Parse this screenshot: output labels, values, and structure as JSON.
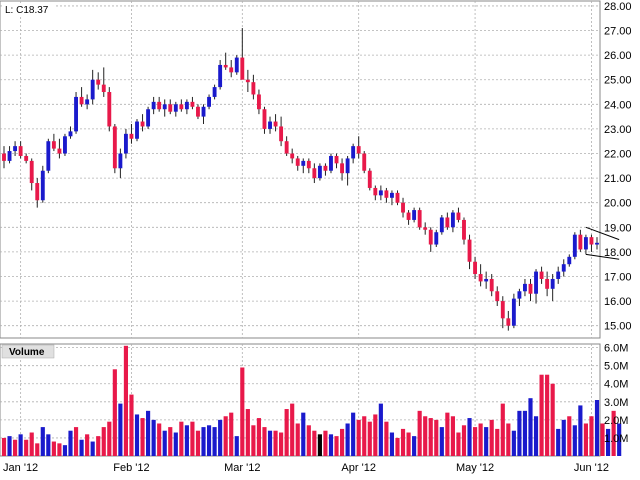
{
  "chart_data": [
    {
      "type": "candlestick",
      "legend_text": "L: C18.37",
      "y_ticks": [
        "28.00",
        "27.00",
        "26.00",
        "25.00",
        "24.00",
        "23.00",
        "22.00",
        "21.00",
        "20.00",
        "19.00",
        "18.00",
        "17.00",
        "16.00",
        "15.00"
      ],
      "ylim": [
        14.5,
        28.2
      ],
      "x_ticks": [
        {
          "label": "Jan '12",
          "index": 3
        },
        {
          "label": "Feb '12",
          "index": 23
        },
        {
          "label": "Mar '12",
          "index": 43
        },
        {
          "label": "Apr '12",
          "index": 64
        },
        {
          "label": "May '12",
          "index": 85
        },
        {
          "label": "Jun '12",
          "index": 106
        }
      ],
      "grid": true,
      "up_color": "#1a1acc",
      "down_color": "#e8194a",
      "ohlc": [
        [
          22.0,
          22.3,
          21.4,
          21.7
        ],
        [
          21.7,
          22.3,
          21.6,
          22.1
        ],
        [
          22.1,
          22.5,
          21.9,
          22.3
        ],
        [
          22.3,
          22.5,
          21.8,
          21.9
        ],
        [
          21.9,
          22.0,
          21.6,
          21.7
        ],
        [
          21.7,
          21.8,
          20.5,
          20.8
        ],
        [
          20.8,
          21.0,
          19.8,
          20.1
        ],
        [
          20.1,
          21.5,
          20.0,
          21.3
        ],
        [
          21.3,
          22.6,
          21.2,
          22.5
        ],
        [
          22.5,
          22.8,
          22.1,
          22.2
        ],
        [
          22.2,
          22.6,
          21.8,
          22.0
        ],
        [
          22.0,
          22.8,
          21.9,
          22.7
        ],
        [
          22.7,
          23.1,
          22.6,
          22.9
        ],
        [
          22.9,
          24.5,
          22.8,
          24.3
        ],
        [
          24.3,
          24.7,
          23.9,
          24.0
        ],
        [
          24.0,
          24.4,
          23.8,
          24.2
        ],
        [
          24.2,
          25.4,
          24.0,
          25.0
        ],
        [
          25.0,
          25.3,
          24.6,
          24.8
        ],
        [
          24.8,
          25.5,
          24.3,
          24.5
        ],
        [
          24.5,
          24.7,
          22.9,
          23.1
        ],
        [
          23.1,
          23.2,
          21.2,
          21.4
        ],
        [
          21.4,
          22.2,
          21.0,
          22.0
        ],
        [
          22.0,
          23.0,
          21.8,
          22.8
        ],
        [
          22.8,
          23.2,
          22.4,
          22.6
        ],
        [
          22.6,
          23.4,
          22.5,
          23.3
        ],
        [
          23.3,
          23.6,
          22.9,
          23.1
        ],
        [
          23.1,
          23.9,
          23.0,
          23.8
        ],
        [
          23.8,
          24.3,
          23.6,
          24.1
        ],
        [
          24.1,
          24.3,
          23.7,
          23.8
        ],
        [
          23.8,
          24.2,
          23.5,
          24.0
        ],
        [
          24.0,
          24.2,
          23.6,
          23.7
        ],
        [
          23.7,
          24.1,
          23.5,
          24.0
        ],
        [
          24.0,
          24.2,
          23.7,
          23.8
        ],
        [
          23.8,
          24.2,
          23.6,
          24.1
        ],
        [
          24.1,
          24.3,
          23.8,
          23.9
        ],
        [
          23.9,
          24.0,
          23.4,
          23.5
        ],
        [
          23.5,
          24.0,
          23.2,
          23.9
        ],
        [
          23.9,
          24.4,
          23.8,
          24.3
        ],
        [
          24.3,
          24.8,
          24.2,
          24.7
        ],
        [
          24.7,
          25.8,
          24.6,
          25.6
        ],
        [
          25.6,
          26.1,
          25.4,
          25.5
        ],
        [
          25.5,
          25.8,
          25.1,
          25.3
        ],
        [
          25.3,
          26.0,
          25.2,
          25.9
        ],
        [
          25.9,
          27.1,
          25.3,
          25.0
        ],
        [
          25.0,
          25.4,
          24.5,
          24.9
        ],
        [
          24.9,
          25.2,
          24.2,
          24.4
        ],
        [
          24.4,
          24.6,
          23.6,
          23.8
        ],
        [
          23.8,
          23.9,
          22.8,
          23.0
        ],
        [
          23.0,
          23.5,
          22.8,
          23.3
        ],
        [
          23.3,
          23.6,
          22.9,
          23.1
        ],
        [
          23.1,
          23.5,
          22.3,
          22.5
        ],
        [
          22.5,
          22.7,
          21.9,
          22.0
        ],
        [
          22.0,
          22.2,
          21.6,
          21.8
        ],
        [
          21.8,
          21.9,
          21.3,
          21.5
        ],
        [
          21.5,
          21.8,
          21.2,
          21.7
        ],
        [
          21.7,
          21.8,
          21.2,
          21.4
        ],
        [
          21.4,
          21.6,
          20.8,
          21.0
        ],
        [
          21.0,
          21.6,
          20.9,
          21.5
        ],
        [
          21.5,
          21.6,
          21.1,
          21.3
        ],
        [
          21.3,
          22.0,
          21.2,
          21.9
        ],
        [
          21.9,
          22.0,
          21.4,
          21.6
        ],
        [
          21.6,
          21.8,
          20.9,
          21.2
        ],
        [
          21.2,
          21.9,
          20.7,
          21.8
        ],
        [
          21.8,
          22.4,
          21.6,
          22.3
        ],
        [
          22.3,
          22.7,
          21.8,
          22.0
        ],
        [
          22.0,
          22.1,
          21.2,
          21.3
        ],
        [
          21.3,
          21.4,
          20.5,
          20.6
        ],
        [
          20.6,
          20.7,
          20.1,
          20.3
        ],
        [
          20.3,
          20.7,
          20.1,
          20.5
        ],
        [
          20.5,
          20.6,
          20.0,
          20.2
        ],
        [
          20.2,
          20.5,
          19.9,
          20.4
        ],
        [
          20.4,
          20.5,
          19.9,
          20.0
        ],
        [
          20.0,
          20.2,
          19.4,
          19.6
        ],
        [
          19.6,
          19.7,
          19.1,
          19.3
        ],
        [
          19.3,
          19.8,
          19.2,
          19.7
        ],
        [
          19.7,
          19.8,
          18.9,
          19.0
        ],
        [
          19.0,
          19.2,
          18.7,
          18.9
        ],
        [
          18.9,
          19.0,
          18.0,
          18.3
        ],
        [
          18.3,
          18.9,
          18.2,
          18.8
        ],
        [
          18.8,
          19.5,
          18.7,
          19.4
        ],
        [
          19.4,
          19.6,
          18.9,
          19.0
        ],
        [
          19.0,
          19.7,
          18.8,
          19.6
        ],
        [
          19.6,
          19.8,
          19.2,
          19.3
        ],
        [
          19.3,
          19.4,
          18.3,
          18.5
        ],
        [
          18.5,
          18.7,
          17.3,
          17.6
        ],
        [
          17.6,
          17.8,
          16.9,
          17.1
        ],
        [
          17.1,
          17.5,
          16.6,
          16.8
        ],
        [
          16.8,
          17.2,
          16.5,
          16.9
        ],
        [
          16.9,
          17.1,
          16.2,
          16.4
        ],
        [
          16.4,
          16.6,
          15.8,
          16.0
        ],
        [
          16.0,
          16.2,
          14.9,
          15.3
        ],
        [
          15.3,
          15.6,
          14.8,
          15.0
        ],
        [
          15.0,
          16.3,
          14.9,
          16.1
        ],
        [
          16.1,
          16.5,
          15.8,
          16.4
        ],
        [
          16.4,
          16.9,
          16.2,
          16.7
        ],
        [
          16.7,
          16.9,
          16.0,
          16.3
        ],
        [
          16.3,
          17.3,
          15.9,
          17.2
        ],
        [
          17.2,
          17.4,
          16.7,
          16.9
        ],
        [
          16.9,
          17.2,
          16.2,
          16.5
        ],
        [
          16.5,
          17.1,
          16.0,
          16.9
        ],
        [
          16.9,
          17.4,
          16.7,
          17.2
        ],
        [
          17.2,
          17.7,
          17.0,
          17.5
        ],
        [
          17.5,
          17.9,
          17.4,
          17.8
        ],
        [
          17.8,
          18.8,
          17.7,
          18.7
        ],
        [
          18.7,
          18.9,
          18.0,
          18.1
        ],
        [
          18.1,
          18.7,
          17.9,
          18.6
        ],
        [
          18.6,
          18.7,
          18.0,
          18.3
        ],
        [
          18.3,
          18.6,
          18.1,
          18.37
        ]
      ],
      "trendlines": [
        {
          "from": [
            105,
            19.0
          ],
          "to": [
            111,
            18.5
          ]
        },
        {
          "from": [
            105,
            17.9
          ],
          "to": [
            111,
            17.7
          ]
        }
      ]
    },
    {
      "type": "bar",
      "label": "Volume",
      "y_ticks": [
        "6.0M",
        "5.0M",
        "4.0M",
        "3.0M",
        "2.0M",
        "1.0M"
      ],
      "ylim": [
        0,
        6.2
      ],
      "values": [
        1.0,
        1.1,
        0.9,
        1.2,
        0.9,
        1.3,
        0.7,
        1.6,
        1.2,
        0.8,
        0.7,
        0.6,
        1.4,
        1.6,
        0.9,
        1.2,
        0.8,
        1.1,
        1.6,
        1.9,
        4.8,
        2.9,
        6.1,
        3.4,
        2.3,
        2.1,
        2.5,
        2.0,
        1.8,
        1.4,
        1.6,
        1.3,
        1.9,
        1.7,
        1.9,
        1.4,
        1.6,
        1.7,
        1.6,
        2.0,
        2.2,
        2.4,
        1.1,
        4.9,
        2.6,
        1.7,
        2.1,
        1.6,
        1.4,
        1.4,
        1.3,
        2.6,
        2.9,
        1.8,
        2.4,
        1.7,
        1.4,
        1.2,
        1.4,
        1.2,
        1.1,
        1.5,
        1.8,
        2.4,
        2.0,
        2.2,
        1.9,
        2.3,
        2.9,
        1.9,
        1.3,
        1.0,
        1.5,
        1.3,
        1.1,
        2.5,
        2.2,
        2.1,
        2.0,
        1.6,
        2.4,
        2.2,
        1.3,
        1.7,
        2.1,
        1.6,
        1.8,
        1.6,
        2.0,
        1.5,
        2.9,
        1.8,
        1.4,
        2.5,
        2.5,
        3.2,
        2.2,
        4.5,
        4.5,
        4.0,
        1.5,
        2.0,
        2.2,
        1.7,
        2.8,
        1.8,
        2.2,
        3.1,
        1.8,
        1.5,
        2.5,
        1.8
      ],
      "colors": [
        "d",
        "u",
        "d",
        "u",
        "d",
        "d",
        "d",
        "u",
        "u",
        "d",
        "d",
        "u",
        "u",
        "d",
        "u",
        "d",
        "u",
        "d",
        "d",
        "d",
        "d",
        "u",
        "d",
        "d",
        "u",
        "d",
        "u",
        "u",
        "d",
        "u",
        "d",
        "u",
        "d",
        "u",
        "d",
        "d",
        "u",
        "u",
        "u",
        "u",
        "d",
        "d",
        "u",
        "d",
        "d",
        "d",
        "d",
        "d",
        "u",
        "d",
        "d",
        "d",
        "d",
        "d",
        "u",
        "d",
        "d",
        "u",
        "d",
        "u",
        "d",
        "d",
        "u",
        "u",
        "d",
        "d",
        "d",
        "d",
        "u",
        "d",
        "u",
        "d",
        "d",
        "d",
        "u",
        "d",
        "d",
        "d",
        "d",
        "u",
        "d",
        "d",
        "d",
        "d",
        "u",
        "d",
        "d",
        "u",
        "d",
        "d",
        "d",
        "d",
        "u",
        "u",
        "u",
        "u",
        "u",
        "d",
        "d",
        "d",
        "u",
        "u",
        "d",
        "u",
        "u",
        "d",
        "d",
        "u",
        "d",
        "u",
        "d",
        "u"
      ],
      "black_bar_index": 57
    }
  ]
}
